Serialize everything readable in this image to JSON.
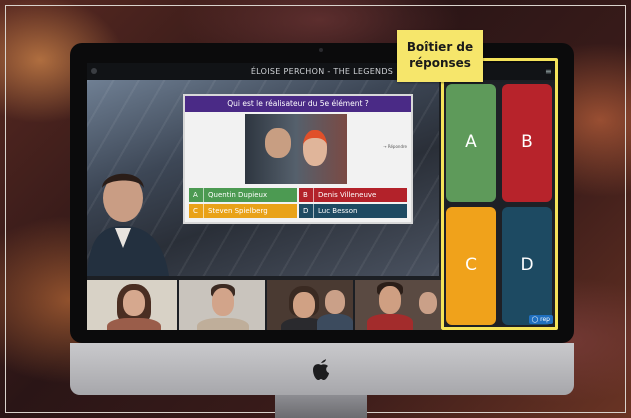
{
  "window": {
    "title": "ÉLOISE PERCHON - THE LEGENDS",
    "menu": "≡"
  },
  "quiz": {
    "question": "Qui est le réalisateur du 5e élément ?",
    "side_text": "→ Répondre",
    "answers": [
      {
        "letter": "A",
        "text": "Quentin Dupieux",
        "color": "#4c9a52"
      },
      {
        "letter": "B",
        "text": "Denis Villeneuve",
        "color": "#b3222a"
      },
      {
        "letter": "C",
        "text": "Steven Spielberg",
        "color": "#e9a218"
      },
      {
        "letter": "D",
        "text": "Luc Besson",
        "color": "#1e4a62"
      }
    ]
  },
  "answer_box": {
    "label_line1": "Boîtier de",
    "label_line2": "réponses",
    "buttons": [
      {
        "letter": "A",
        "color": "#5e9a5a"
      },
      {
        "letter": "B",
        "color": "#b7232b"
      },
      {
        "letter": "C",
        "color": "#f0a21b"
      },
      {
        "letter": "D",
        "color": "#1d4a62"
      }
    ],
    "badge": "◯ rep"
  },
  "participants": [
    "participant-1",
    "participant-2",
    "participant-3",
    "participant-4",
    "participant-5"
  ]
}
